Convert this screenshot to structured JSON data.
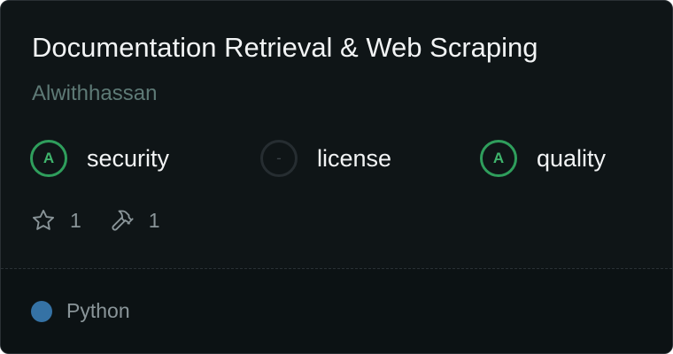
{
  "server": {
    "title": "Documentation Retrieval & Web Scraping",
    "author": "Alwithhassan"
  },
  "scores": [
    {
      "grade": "A",
      "label": "security",
      "state": "graded"
    },
    {
      "grade": "-",
      "label": "license",
      "state": "none"
    },
    {
      "grade": "A",
      "label": "quality",
      "state": "graded"
    }
  ],
  "stats": {
    "stars": "1",
    "tools": "1",
    "star_icon": "star-icon",
    "tool_icon": "hammer-icon"
  },
  "footer": {
    "language": "Python",
    "language_color": "#3572a5"
  },
  "colors": {
    "card_background": "#0f1517",
    "grade_green": "#3fb56d",
    "author_text": "#5e7a76"
  }
}
